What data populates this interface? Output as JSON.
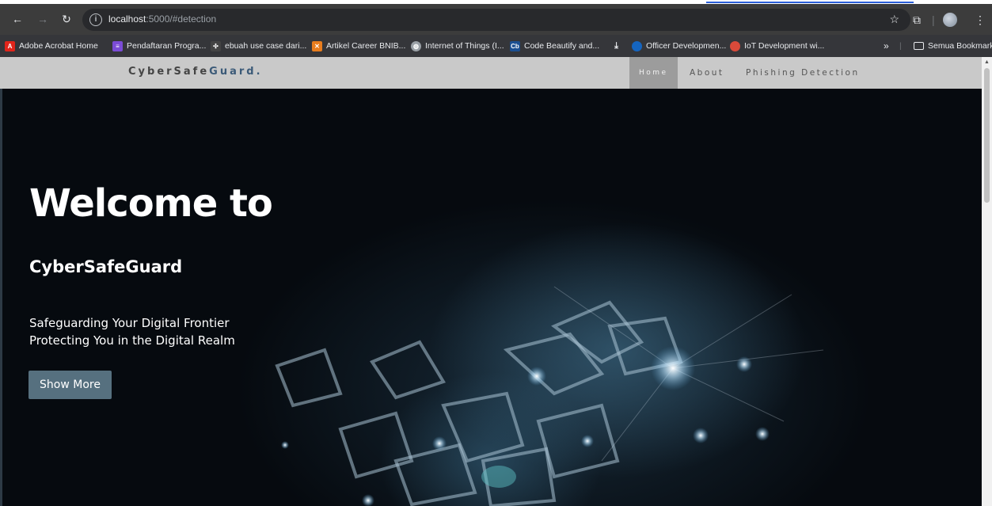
{
  "browser": {
    "url_host": "localhost",
    "url_path": ":5000/#detection",
    "bookmarks": [
      {
        "label": "Adobe Acrobat Home",
        "icon": "adobe-icon",
        "color": "#e1251b"
      },
      {
        "label": "Pendaftaran Progra...",
        "icon": "list-icon",
        "color": "#7b4cd6"
      },
      {
        "label": "ebuah use case dari...",
        "icon": "grid-icon",
        "color": "#444444"
      },
      {
        "label": "Artikel Career BNIB...",
        "icon": "bnib-icon",
        "color": "#e87d1e"
      },
      {
        "label": "Internet of Things (I...",
        "icon": "globe-icon",
        "color": "#9aa0a6"
      },
      {
        "label": "Code Beautify and...",
        "icon": "cb-icon",
        "color": "#1b4f91"
      },
      {
        "label": "",
        "icon": "download-icon",
        "color": "#e8eaed"
      },
      {
        "label": "Officer Developmen...",
        "icon": "officer-icon",
        "color": "#1565c0"
      },
      {
        "label": "IoT Development wi...",
        "icon": "iot-icon",
        "color": "#d94a3a"
      }
    ],
    "overflow_label": "»",
    "folder_label": "Semua Bookmark"
  },
  "site": {
    "logo_main": "CyberSafe",
    "logo_accent": "Guard.",
    "nav": [
      {
        "label": "Home",
        "active": true
      },
      {
        "label": "About",
        "active": false
      },
      {
        "label": "Phishing Detection",
        "active": false
      }
    ]
  },
  "hero": {
    "title": "Welcome to",
    "subtitle": "CyberSafeGuard",
    "tagline_1": "Safeguarding Your Digital Frontier",
    "tagline_2": "Protecting You in the Digital Realm",
    "button_label": "Show More"
  },
  "colors": {
    "button": "#56707f",
    "logo_accent": "#3b5a78",
    "nav_active": "#9c9c9c"
  }
}
